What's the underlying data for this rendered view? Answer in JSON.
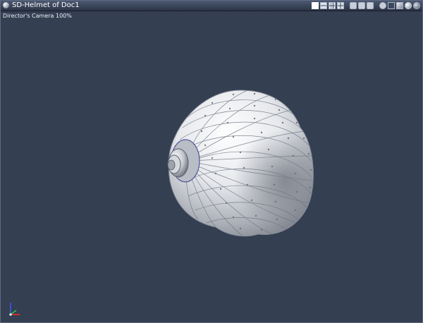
{
  "window": {
    "title": "SD-Helmet of Doc1"
  },
  "toolbar": {
    "icons": [
      "single-view-layout-icon",
      "two-view-layout-icon",
      "three-view-layout-icon",
      "four-view-layout-icon",
      "camera-orbit-icon",
      "camera-pan-icon",
      "camera-zoom-icon",
      "figure-select-icon",
      "wireframe-cube-icon",
      "solid-cube-icon",
      "smooth-shaded-sphere-icon",
      "shaded-sphere-icon"
    ]
  },
  "viewport": {
    "camera_label": "Director's Camera 100%",
    "object": "SD-Helmet",
    "colors": {
      "background": "#343f52",
      "mesh_surface": "#d4d7dc",
      "wire": "#6f7581",
      "selection": "#3a46c8"
    }
  },
  "axis": {
    "x_color": "#ff2a2a",
    "y_color": "#2ee03a",
    "z_color": "#3a5bff"
  }
}
